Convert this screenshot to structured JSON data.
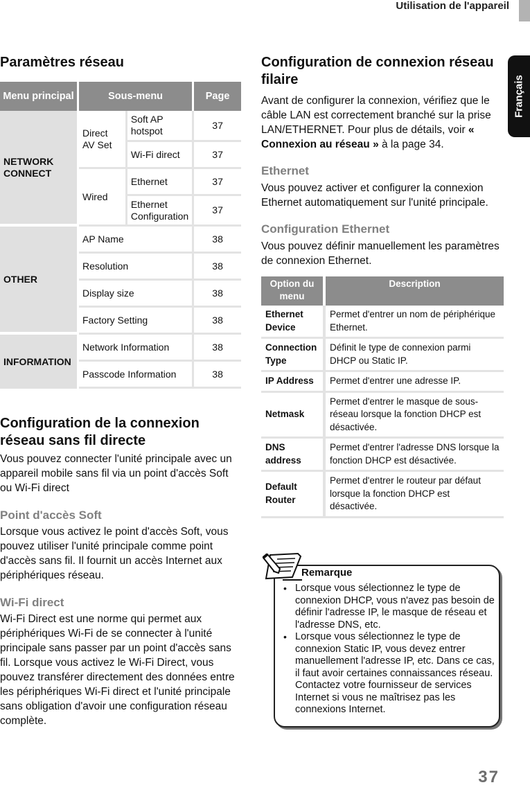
{
  "header": {
    "section_title": "Utilisation de l'appareil",
    "language_tab": "Français"
  },
  "left": {
    "title": "Paramètres réseau",
    "table": {
      "headers": [
        "Menu principal",
        "Sous-menu",
        "Page"
      ],
      "groups": [
        {
          "main": "NETWORK CONNECT",
          "subgroups": [
            {
              "name": "Direct AV Set",
              "items": [
                {
                  "label": "Soft AP hotspot",
                  "page": "37"
                },
                {
                  "label": "Wi-Fi direct",
                  "page": "37"
                }
              ]
            },
            {
              "name": "Wired",
              "items": [
                {
                  "label": "Ethernet",
                  "page": "37"
                },
                {
                  "label": "Ethernet Configuration",
                  "page": "37"
                }
              ]
            }
          ]
        },
        {
          "main": "OTHER",
          "items": [
            {
              "label": "AP Name",
              "page": "38"
            },
            {
              "label": "Resolution",
              "page": "38"
            },
            {
              "label": "Display size",
              "page": "38"
            },
            {
              "label": "Factory Setting",
              "page": "38"
            }
          ]
        },
        {
          "main": "INFORMATION",
          "items": [
            {
              "label": "Network Information",
              "page": "38"
            },
            {
              "label": "Passcode Information",
              "page": "38"
            }
          ]
        }
      ]
    },
    "wireless": {
      "title": "Configuration de la connexion réseau sans fil directe",
      "intro": "Vous pouvez connecter l'unité principale avec un appareil mobile sans fil via un point d'accès Soft ou Wi-Fi direct",
      "soft_ap_title": "Point d'accès Soft",
      "soft_ap_text": "Lorsque vous activez le point d'accès Soft, vous pouvez utiliser l'unité principale comme point d'accès sans fil. Il fournit un accès Internet aux périphériques réseau.",
      "wifi_direct_title": "Wi-Fi direct",
      "wifi_direct_text": "Wi-Fi Direct est une norme qui permet aux périphériques Wi-Fi de se connecter à l'unité principale sans passer par un point d'accès sans fil. Lorsque vous activez le Wi-Fi Direct, vous pouvez transférer directement des données entre les périphériques Wi-Fi direct et l'unité principale sans obligation d'avoir une configuration réseau complète."
    }
  },
  "right": {
    "title": "Configuration de connexion réseau filaire",
    "intro_before": "Avant de configurer la connexion, vérifiez que le câble LAN est correctement branché sur la prise LAN/ETHERNET. Pour plus de détails, voir ",
    "intro_link": "« Connexion au réseau »",
    "intro_after": " à la page 34.",
    "ethernet_title": "Ethernet",
    "ethernet_text": "Vous pouvez activer et configurer la connexion Ethernet automatiquement sur l'unité principale.",
    "eth_config_title": "Configuration Ethernet",
    "eth_config_text": "Vous pouvez définir manuellement les paramètres de connexion Ethernet.",
    "table": {
      "headers": [
        "Option du menu",
        "Description"
      ],
      "rows": [
        {
          "option": "Ethernet Device",
          "description": "Permet d'entrer un nom de périphérique Ethernet."
        },
        {
          "option": "Connection Type",
          "description": "Définit le type de connexion parmi DHCP ou Static IP."
        },
        {
          "option": "IP Address",
          "description": "Permet d'entrer une adresse IP."
        },
        {
          "option": "Netmask",
          "description": "Permet d'entrer le masque de sous-réseau lorsque la fonction DHCP est désactivée."
        },
        {
          "option": "DNS address",
          "description": "Permet d'entrer l'adresse DNS lorsque la fonction DHCP est désactivée."
        },
        {
          "option": "Default Router",
          "description": "Permet d'entrer le routeur par défaut lorsque la fonction DHCP est désactivée."
        }
      ]
    },
    "note": {
      "icon": "note-pencil-icon",
      "title": "Remarque",
      "items": [
        "Lorsque vous sélectionnez le type de connexion DHCP, vous n'avez pas besoin de définir l'adresse IP, le masque de réseau et l'adresse DNS, etc.",
        "Lorsque vous sélectionnez le type de connexion Static IP, vous devez entrer manuellement l'adresse IP, etc. Dans ce cas, il faut avoir certaines connaissances réseau. Contactez votre fournisseur de services Internet si vous ne maîtrisez pas les connexions Internet."
      ]
    }
  },
  "footer": {
    "page_number": "37"
  }
}
